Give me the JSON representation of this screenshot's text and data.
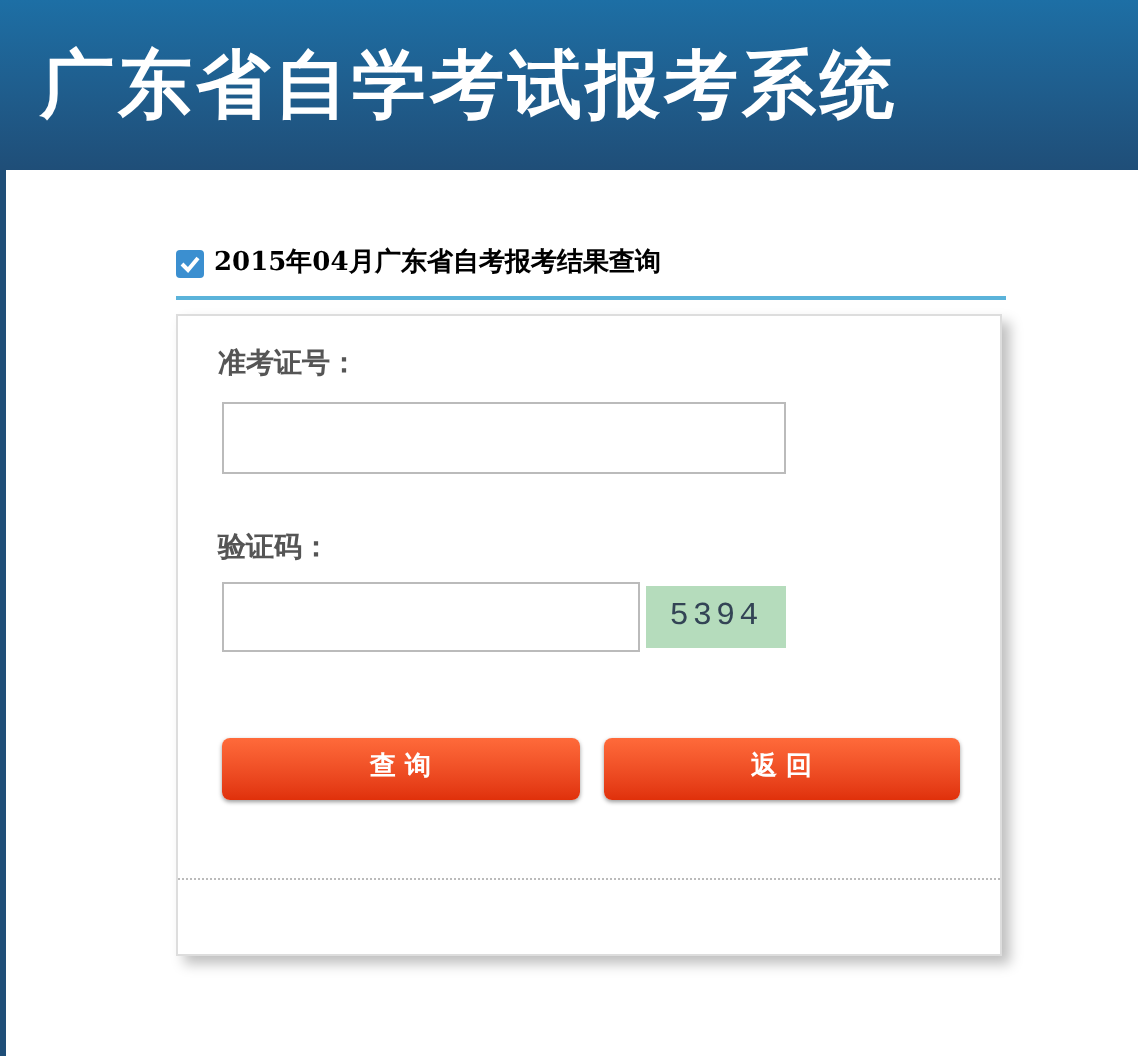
{
  "header": {
    "title": "广东省自学考试报考系统"
  },
  "section": {
    "title": "2015年04月广东省自考报考结果查询"
  },
  "form": {
    "fields": [
      {
        "label": "准考证号："
      },
      {
        "label": "验证码：",
        "captcha": "5394"
      }
    ],
    "buttons": [
      "查 询",
      "返 回"
    ]
  }
}
